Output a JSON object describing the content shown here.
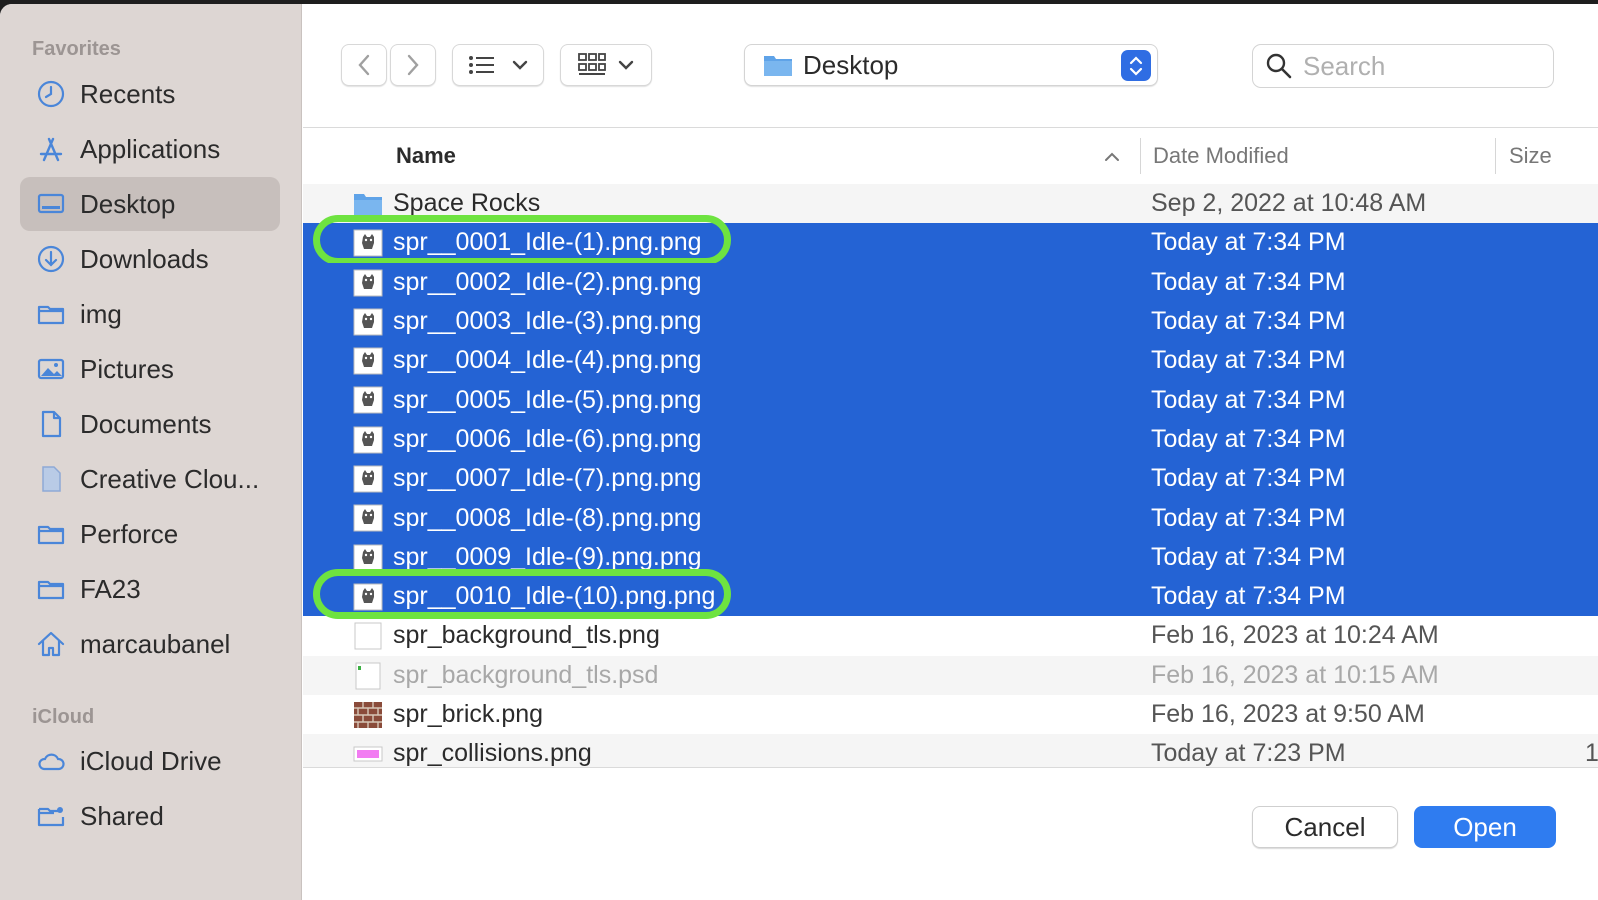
{
  "sidebar": {
    "favorites_header": "Favorites",
    "icloud_header": "iCloud",
    "favorites": [
      {
        "label": "Recents",
        "icon": "clock-icon"
      },
      {
        "label": "Applications",
        "icon": "applications-icon"
      },
      {
        "label": "Desktop",
        "icon": "desktop-icon",
        "selected": true
      },
      {
        "label": "Downloads",
        "icon": "download-icon"
      },
      {
        "label": "img",
        "icon": "folder-icon"
      },
      {
        "label": "Pictures",
        "icon": "pictures-icon"
      },
      {
        "label": "Documents",
        "icon": "document-icon"
      },
      {
        "label": "Creative Clou...",
        "icon": "file-icon"
      },
      {
        "label": "Perforce",
        "icon": "folder-icon"
      },
      {
        "label": "FA23",
        "icon": "folder-icon"
      },
      {
        "label": "marcaubanel",
        "icon": "home-icon"
      }
    ],
    "icloud": [
      {
        "label": "iCloud Drive",
        "icon": "cloud-icon"
      },
      {
        "label": "Shared",
        "icon": "shared-folder-icon"
      }
    ]
  },
  "toolbar": {
    "location": "Desktop",
    "search_placeholder": "Search"
  },
  "columns": {
    "name": "Name",
    "date": "Date Modified",
    "size": "Size"
  },
  "files": [
    {
      "name": "Space Rocks",
      "date": "Sep 2, 2022 at 10:48 AM",
      "type": "folder",
      "selected": false
    },
    {
      "name": "spr__0001_Idle-(1).png.png",
      "date": "Today at 7:34 PM",
      "type": "sprite",
      "selected": true,
      "highlighted": true
    },
    {
      "name": "spr__0002_Idle-(2).png.png",
      "date": "Today at 7:34 PM",
      "type": "sprite",
      "selected": true
    },
    {
      "name": "spr__0003_Idle-(3).png.png",
      "date": "Today at 7:34 PM",
      "type": "sprite",
      "selected": true
    },
    {
      "name": "spr__0004_Idle-(4).png.png",
      "date": "Today at 7:34 PM",
      "type": "sprite",
      "selected": true
    },
    {
      "name": "spr__0005_Idle-(5).png.png",
      "date": "Today at 7:34 PM",
      "type": "sprite",
      "selected": true
    },
    {
      "name": "spr__0006_Idle-(6).png.png",
      "date": "Today at 7:34 PM",
      "type": "sprite",
      "selected": true
    },
    {
      "name": "spr__0007_Idle-(7).png.png",
      "date": "Today at 7:34 PM",
      "type": "sprite",
      "selected": true
    },
    {
      "name": "spr__0008_Idle-(8).png.png",
      "date": "Today at 7:34 PM",
      "type": "sprite",
      "selected": true
    },
    {
      "name": "spr__0009_Idle-(9).png.png",
      "date": "Today at 7:34 PM",
      "type": "sprite",
      "selected": true
    },
    {
      "name": "spr__0010_Idle-(10).png.png",
      "date": "Today at 7:34 PM",
      "type": "sprite",
      "selected": true,
      "highlighted": true
    },
    {
      "name": "spr_background_tls.png",
      "date": "Feb 16, 2023 at 10:24 AM",
      "type": "blank",
      "selected": false
    },
    {
      "name": "spr_background_tls.psd",
      "date": "Feb 16, 2023 at 10:15 AM",
      "type": "psd",
      "selected": false,
      "dimmed": true
    },
    {
      "name": "spr_brick.png",
      "date": "Feb 16, 2023 at 9:50 AM",
      "type": "brick",
      "selected": false
    },
    {
      "name": "spr_collisions.png",
      "date": "Today at 7:23 PM",
      "type": "pink",
      "selected": false,
      "size": "1"
    }
  ],
  "buttons": {
    "cancel": "Cancel",
    "open": "Open"
  },
  "colors": {
    "selection": "#2463d4",
    "highlight": "#6ee340",
    "accent": "#2f7cf0",
    "sidebar_bg": "#ddd6d3"
  }
}
